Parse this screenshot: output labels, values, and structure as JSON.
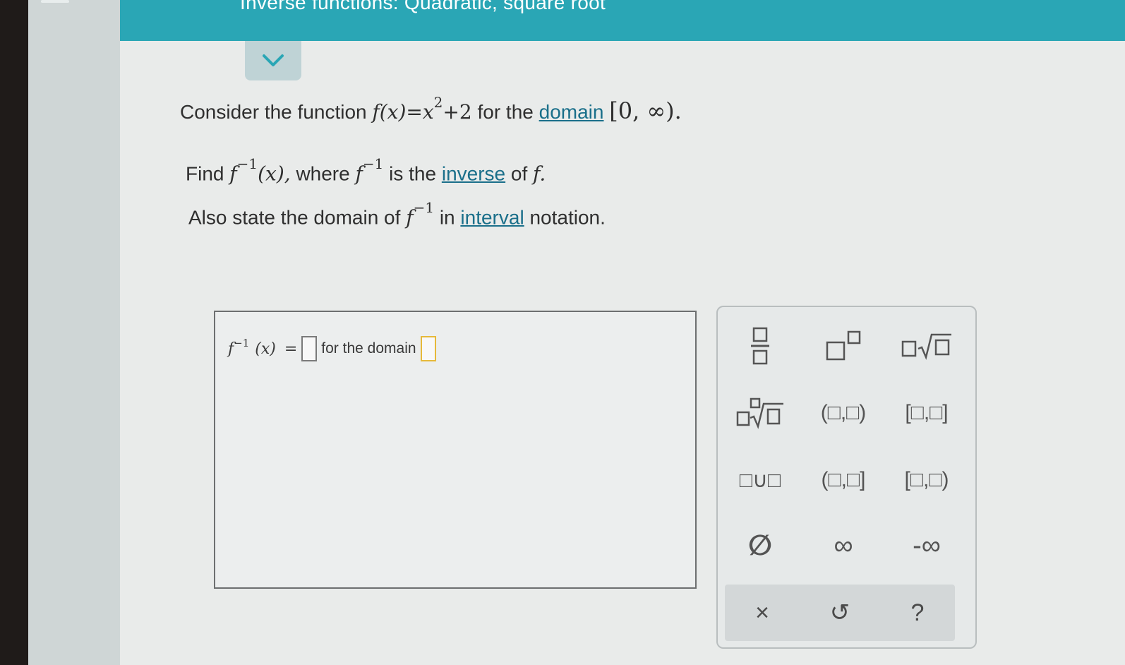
{
  "header": {
    "title": "Inverse functions: Quadratic, square root"
  },
  "question": {
    "line1_prefix": "Consider the function",
    "line1_fx": "f(x)",
    "line1_eq": "=",
    "line1_x": "x",
    "line1_exp": "2",
    "line1_plus": "+2",
    "line1_mid": "for the",
    "line1_link": "domain",
    "line1_interval": "[0, ∞).",
    "line2_find": "Find",
    "line2_f": "f",
    "line2_inv": "−1",
    "line2_x": "(x),",
    "line2_where": "where",
    "line2_f2": "f",
    "line2_inv2": "−1",
    "line2_is": "is the",
    "line2_link": "inverse",
    "line2_of": "of",
    "line2_f3": "f.",
    "line3_prefix": "Also state the domain of",
    "line3_f": "f",
    "line3_inv": "−1",
    "line3_in": "in",
    "line3_link": "interval",
    "line3_suffix": "notation."
  },
  "answer": {
    "f": "f",
    "inv": "−1",
    "x": "(x)",
    "eq": "=",
    "domain_label": "for the domain"
  },
  "keypad": {
    "keys": [
      "□/□",
      "□^□",
      "□√□",
      "□∛□",
      "(□,□)",
      "[□,□]",
      "□∪□",
      "(□,□]",
      "[□,□)",
      "∅",
      "∞",
      "-∞"
    ],
    "clear": "×",
    "undo": "↺",
    "help": "?"
  }
}
